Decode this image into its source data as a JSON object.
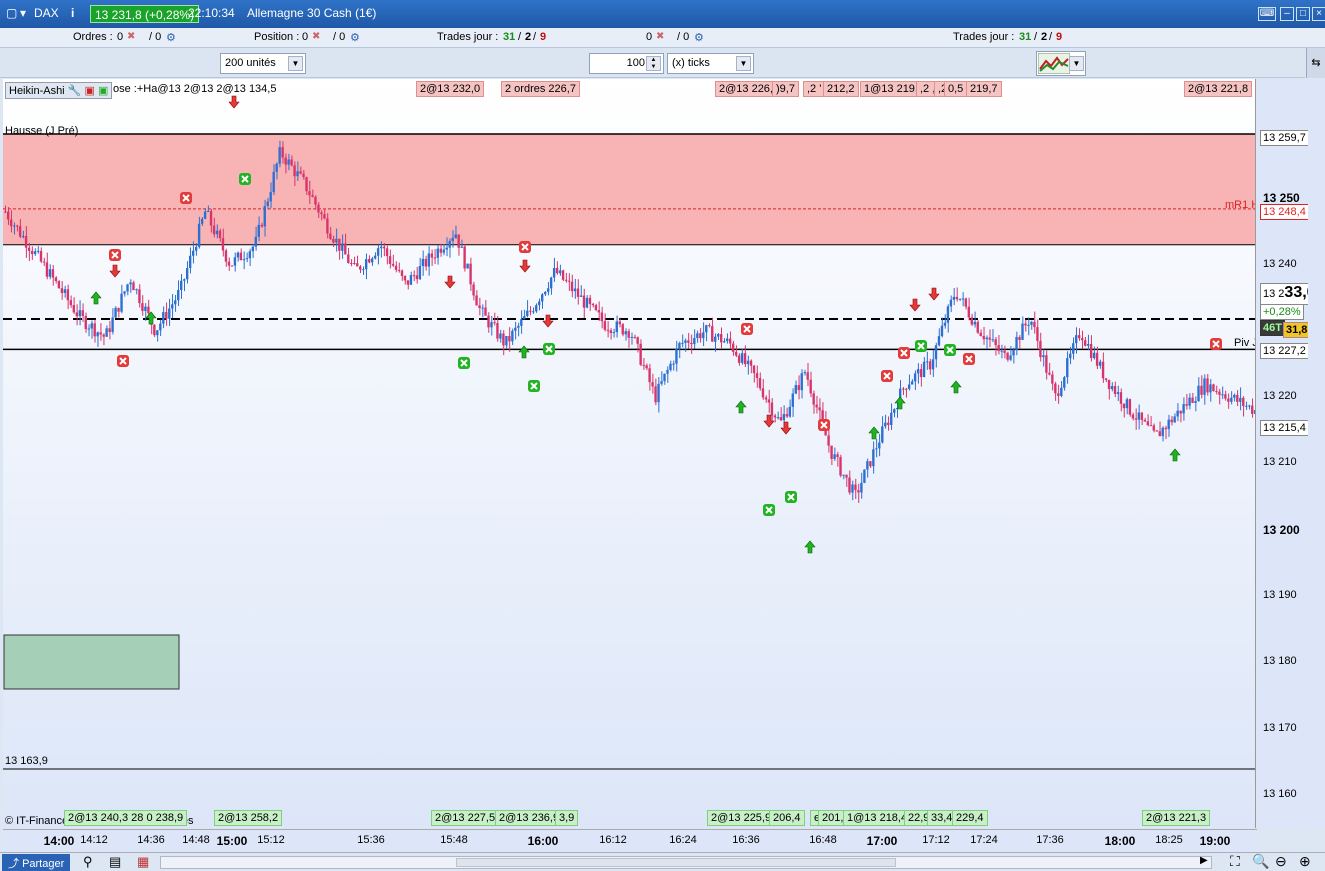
{
  "titlebar": {
    "app": "DAX",
    "info_icon": "i",
    "price_badge": "13 231,8 (+0,28%)",
    "time": "22:10:34",
    "instrument": "Allemagne 30 Cash (1€)"
  },
  "status": {
    "orders_label": "Ordres :",
    "orders_a": "0",
    "orders_b": "/ 0",
    "position_label": "Position :",
    "position_a": "0",
    "position_b": "/ 0",
    "trades1_label": "Trades jour :",
    "trades1_a": "31",
    "trades1_sep1": "/",
    "trades1_b": "2",
    "trades1_sep2": "/",
    "trades1_c": "9",
    "mid_a": "0",
    "mid_b": "/ 0",
    "trades2_label": "Trades jour :",
    "trades2_a": "31",
    "trades2_sep1": "/",
    "trades2_b": "2",
    "trades2_sep2": "/",
    "trades2_c": "9"
  },
  "toolbar": {
    "units": "200 unités",
    "qty": "100",
    "ticks": "(x) ticks"
  },
  "indicator": {
    "name": "Heikin-Ashi",
    "overlay": "ose :+Ha@13 2@13 2@13 134,5"
  },
  "chart_labels": {
    "left_top": "Hausse (J Pré)",
    "mR1": "mR1 H",
    "piv": "Piv J",
    "low": "13 163,9",
    "copyright": "© IT-Finance.com  Données indicatives"
  },
  "top_boxes": [
    {
      "text": "2@13 232,0",
      "color": "r"
    },
    {
      "text": "2 ordres  226,7",
      "color": "r"
    },
    {
      "text": "2@13 226,9",
      "color": "r"
    },
    {
      "text": ")9,7",
      "color": "r"
    },
    {
      "text": ",2 '",
      "color": "r"
    },
    {
      "text": " 212,2",
      "color": "r"
    },
    {
      "text": "1@13 219,0",
      "color": "r"
    },
    {
      "text": ",2 ,7",
      "color": "r"
    },
    {
      "text": ",2",
      "color": "r"
    },
    {
      "text": "0,5",
      "color": "r"
    },
    {
      "text": " 219,7",
      "color": "r"
    },
    {
      "text": "2@13 221,8",
      "color": "r"
    }
  ],
  "bottom_boxes": [
    {
      "text": "2@13 240,3 28 0 238,9",
      "color": "g"
    },
    {
      "text": "2@13 258,2",
      "color": "g"
    },
    {
      "text": "2@13 227,5",
      "color": "g"
    },
    {
      "text": "2@13 236,9",
      "color": "g"
    },
    {
      "text": "3,9",
      "color": "g"
    },
    {
      "text": "2@13 225,9",
      "color": "g"
    },
    {
      "text": "206,4",
      "color": "g"
    },
    {
      "text": "es",
      "color": "g"
    },
    {
      "text": "201,9",
      "color": "g"
    },
    {
      "text": "1@13 218,4",
      "color": "g"
    },
    {
      "text": "22,9",
      "color": "g"
    },
    {
      "text": "33,4",
      "color": "g"
    },
    {
      "text": "229,4",
      "color": "g"
    },
    {
      "text": "2@13 221,3",
      "color": "g"
    }
  ],
  "yaxis": {
    "ticks": [
      "13 250",
      "13 240",
      "13 220",
      "13 210",
      "13 200",
      "13 190",
      "13 180",
      "13 170",
      "13 160"
    ],
    "labels": {
      "top": "13 259,7",
      "mR1": "13 248,4",
      "last_a": "13 2",
      "last_b": "33,0",
      "pct": "+0,28%",
      "ticks_count": "46T",
      "cur": "31,8",
      "piv": "13 227,2",
      "low": "13 215,4"
    }
  },
  "xaxis": {
    "ticks": [
      "14:00",
      "14:12",
      "14:36",
      "14:48",
      "15:00",
      "15:12",
      "15:36",
      "15:48",
      "16:00",
      "16:12",
      "16:24",
      "16:36",
      "16:48",
      "17:00",
      "17:12",
      "17:24",
      "17:36",
      "18:00",
      "18:25",
      "19:00"
    ]
  },
  "bottombar": {
    "share": "Partager"
  },
  "chart_data": {
    "type": "candlestick",
    "ylim": [
      13155,
      13268
    ],
    "x_ticks": [
      "14:00",
      "14:12",
      "14:36",
      "14:48",
      "15:00",
      "15:12",
      "15:36",
      "15:48",
      "16:00",
      "16:12",
      "16:24",
      "16:36",
      "16:48",
      "17:00",
      "17:12",
      "17:24",
      "17:36",
      "18:00",
      "18:25",
      "19:00"
    ],
    "levels": [
      {
        "name": "Hausse (J Pré)",
        "value": 13259.7
      },
      {
        "name": "mR1 H",
        "value": 13248.4
      },
      {
        "name": "Piv J",
        "value": 13227.2
      },
      {
        "name": "low",
        "value": 13163.9
      }
    ],
    "close_path": [
      [
        0,
        13248
      ],
      [
        3,
        13240
      ],
      [
        6,
        13232
      ],
      [
        8,
        13229
      ],
      [
        10,
        13238
      ],
      [
        12,
        13230
      ],
      [
        14,
        13236
      ],
      [
        16,
        13248
      ],
      [
        18,
        13240
      ],
      [
        20,
        13243
      ],
      [
        22,
        13257
      ],
      [
        24,
        13252
      ],
      [
        26,
        13245
      ],
      [
        28,
        13239
      ],
      [
        30,
        13243
      ],
      [
        32,
        13237
      ],
      [
        34,
        13241
      ],
      [
        36,
        13245
      ],
      [
        38,
        13233
      ],
      [
        40,
        13228
      ],
      [
        42,
        13233
      ],
      [
        44,
        13239
      ],
      [
        46,
        13235
      ],
      [
        48,
        13231
      ],
      [
        50,
        13230
      ],
      [
        52,
        13220
      ],
      [
        54,
        13228
      ],
      [
        56,
        13230
      ],
      [
        58,
        13228
      ],
      [
        60,
        13223
      ],
      [
        62,
        13216
      ],
      [
        64,
        13224
      ],
      [
        66,
        13212
      ],
      [
        68,
        13205
      ],
      [
        70,
        13214
      ],
      [
        72,
        13222
      ],
      [
        74,
        13225
      ],
      [
        76,
        13236
      ],
      [
        78,
        13230
      ],
      [
        80,
        13226
      ],
      [
        82,
        13232
      ],
      [
        84,
        13220
      ],
      [
        86,
        13230
      ],
      [
        88,
        13223
      ],
      [
        90,
        13218
      ],
      [
        92,
        13214
      ],
      [
        94,
        13218
      ],
      [
        96,
        13222
      ],
      [
        98,
        13220
      ],
      [
        100,
        13218
      ]
    ],
    "last": 13231.8
  }
}
